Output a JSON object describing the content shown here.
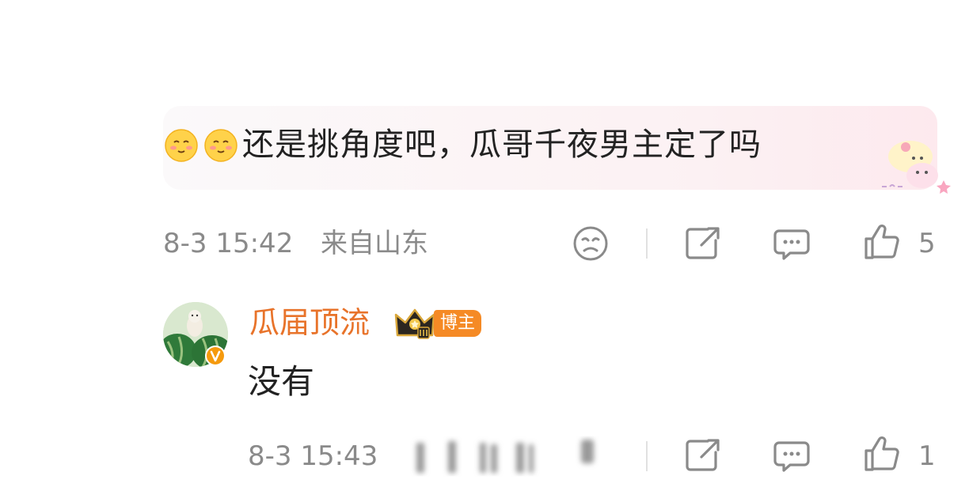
{
  "comment": {
    "text": "还是挑角度吧，瓜哥千夜男主定了吗",
    "time": "8-3 15:42",
    "location": "来自山东",
    "like_count": "5",
    "emoji_icons": [
      "smiling-face-emoji",
      "smiling-face-emoji"
    ]
  },
  "reply": {
    "author": "瓜届顶流",
    "tag": "博主",
    "text": "没有",
    "time": "8-3 15:43",
    "like_count": "1"
  },
  "colors": {
    "author": "#e8732a",
    "tag_bg": "#f58a25",
    "meta": "#8a8a8a",
    "text": "#222222"
  }
}
